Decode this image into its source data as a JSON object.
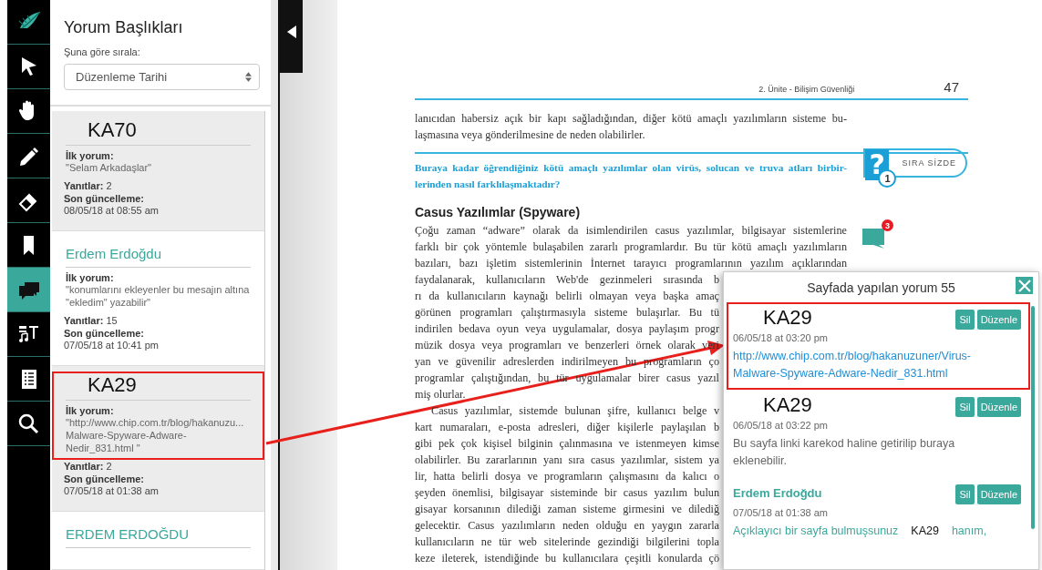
{
  "toolbar": {
    "tools": [
      {
        "kind": "logo",
        "selected": false
      },
      {
        "kind": "pointer",
        "selected": false
      },
      {
        "kind": "hand",
        "selected": false
      },
      {
        "kind": "pencil",
        "selected": false
      },
      {
        "kind": "eraser",
        "selected": false
      },
      {
        "kind": "bookmark",
        "selected": false
      },
      {
        "kind": "comments",
        "selected": true
      },
      {
        "kind": "media",
        "selected": false
      },
      {
        "kind": "list",
        "selected": false
      },
      {
        "kind": "search",
        "selected": false
      }
    ]
  },
  "sidebar": {
    "title": "Yorum Başlıkları",
    "sort_label": "Şuna göre sırala:",
    "sort_value": "Düzenleme Tarihi",
    "threads": [
      {
        "kind": "tag",
        "title": "KA70",
        "marked": false,
        "first_label": "İlk yorum:",
        "first_comment": [
          "\"Selam Arkadaşlar\""
        ],
        "replies": "**Yanıtlar:** 2",
        "updated_label": "Son güncelleme:",
        "updated": "08/05/18 at 08:55 am"
      },
      {
        "kind": "name",
        "title": "Erdem Erdoğdu",
        "marked": false,
        "first_label": "İlk yorum:",
        "first_comment": [
          "\"konumlarını ekleyenler bu mesajın altına",
          "\"ekledim\" yazabilir\""
        ],
        "replies": "**Yanıtlar:** 15",
        "updated_label": "Son güncelleme:",
        "updated": "07/05/18 at 10:41 pm"
      },
      {
        "kind": "tag",
        "title": "KA29",
        "marked": true,
        "first_label": "İlk yorum:",
        "first_comment": [
          "\"http://www.chip.com.tr/blog/hakanuzu...",
          "Malware-Spyware-Adware-",
          "Nedir_831.html \""
        ],
        "replies": "**Yanıtlar:** 2",
        "updated_label": "Son güncelleme:",
        "updated": "07/05/18 at 01:38 am"
      },
      {
        "kind": "name",
        "title": "ERDEM ERDOĞDU",
        "marked": false
      }
    ]
  },
  "document": {
    "header": "2. Ünite - Bilişim Güvenliği",
    "page_number": "47",
    "intro_lines": [
      {
        "kind": "full",
        "text": "lanıcıdan habersiz açık bir kapı sağladığından, diğer kötü amaçlı yazılımların sisteme bu-"
      },
      {
        "kind": "end",
        "text": "laşmasına veya gönderilmesine de neden olabilirler."
      }
    ],
    "question": {
      "lines": [
        {
          "kind": "full",
          "text": "Buraya kadar öğrendiğiniz kötü amaçlı yazılımlar olan virüs, solucan ve truva atları birbir-"
        },
        {
          "kind": "end",
          "text": "lerinden nasıl farklılaşmaktadır?"
        }
      ],
      "symbol": "?",
      "number": "1",
      "badge": "SIRA SİZDE"
    },
    "heading": "Casus Yazılımlar (Spyware)",
    "comment_count": "3",
    "lines": [
      {
        "kind": "full",
        "text": "Çoğu zaman “adware” olarak da isimlendirilen casus yazılımlar, bilgisayar sistemlerine"
      },
      {
        "kind": "full",
        "text": "farklı bir çok yöntemle bulaşabilen zararlı programlardır. Bu tür kötü amaçlı yazılımların"
      },
      {
        "kind": "full",
        "text": "bazıları, bazı işletim sistemlerinin İnternet tarayıcı programlarının yazılım açıklarından"
      },
      {
        "kind": "cut",
        "text": "faydalanarak, kullanıcıların Web'de gezinmeleri sırasında b"
      },
      {
        "kind": "cut",
        "text": "rı da kullanıcıların kaynağı belirli olmayan veya başka amaç"
      },
      {
        "kind": "cut",
        "text": "görünen programları çalıştırmasıyla sisteme bulaşırlar. Bu tü"
      },
      {
        "kind": "cut",
        "text": "indirilen bedava oyun veya uygulamalar, dosya paylaşım progr"
      },
      {
        "kind": "cut",
        "text": "müzik dosya veya programları ve benzerleri örnek olarak veri"
      },
      {
        "kind": "cut",
        "text": "yan ve güvenilir adreslerden indirilmeyen bu programların ço"
      },
      {
        "kind": "cut",
        "text": "programlar çalıştığından, bu tür uygulamalar birer casus yazıl"
      },
      {
        "kind": "end",
        "text": "miş olurlar."
      },
      {
        "kind": "indent",
        "text": "Casus yazılımlar, sistemde bulunan şifre, kullanıcı belge v"
      },
      {
        "kind": "cut",
        "text": "kart numaraları, e-posta adresleri, diğer kişilerle paylaşılan b"
      },
      {
        "kind": "cut",
        "text": "gibi pek çok kişisel bilginin çalınmasına ve istenmeyen kimse"
      },
      {
        "kind": "cut",
        "text": "olabilirler. Bu zararlarının yanı sıra casus yazılımlar, sistem ya"
      },
      {
        "kind": "cut",
        "text": "lir, hatta belirli dosya ve programların çalışmasını da kalıcı o"
      },
      {
        "kind": "cut",
        "text": "şeyden önemlisi, bilgisayar sisteminde bir casus yazılım bulun"
      },
      {
        "kind": "cut",
        "text": "gisayar korsanının dilediği zaman sisteme girmesini ve dilediğ"
      },
      {
        "kind": "cut",
        "text": "gelecektir. Casus yazılımların neden olduğu en yaygın zararla"
      },
      {
        "kind": "cut",
        "text": "kullanıcıların ne tür web sitelerinde gezindiği bilgilerini topla"
      },
      {
        "kind": "cut",
        "text": "keze ileterek, istendiğinde bu kullanıcılara çeşitli konularda çö"
      }
    ]
  },
  "popup": {
    "title": "Sayfada yapılan yorum 55",
    "comments": [
      {
        "kind": "tag",
        "author": "KA29",
        "marked": true,
        "date": "06/05/18 at 03:20 pm",
        "buttons": [
          "Sil",
          "Düzenle"
        ],
        "body": [
          [
            {
              "kind": "link",
              "text": "http://www.chip.com.tr/blog/hakanuzuner/Virus-"
            }
          ],
          [
            {
              "kind": "link",
              "text": "Malware-Spyware-Adware-Nedir_831.html"
            }
          ]
        ]
      },
      {
        "kind": "tag",
        "author": "KA29",
        "marked": false,
        "date": "06/05/18 at 03:22 pm",
        "buttons": [
          "Sil",
          "Düzenle"
        ],
        "body": [
          [
            {
              "kind": "plain",
              "text": "Bu sayfa linki karekod haline getirilip buraya"
            }
          ],
          [
            {
              "kind": "plain",
              "text": "eklenebilir."
            }
          ]
        ]
      },
      {
        "kind": "name",
        "author": "Erdem Erdoğdu",
        "marked": false,
        "date": "07/05/18 at 01:38 am",
        "buttons": [
          "Sil",
          "Düzenle"
        ],
        "body": [
          [
            {
              "kind": "reply",
              "text": "Açıklayıcı bir sayfa bulmuşsunuz"
            },
            {
              "kind": "mention",
              "text": "KA29"
            },
            {
              "kind": "reply",
              "text": "hanım,"
            }
          ]
        ]
      }
    ]
  }
}
